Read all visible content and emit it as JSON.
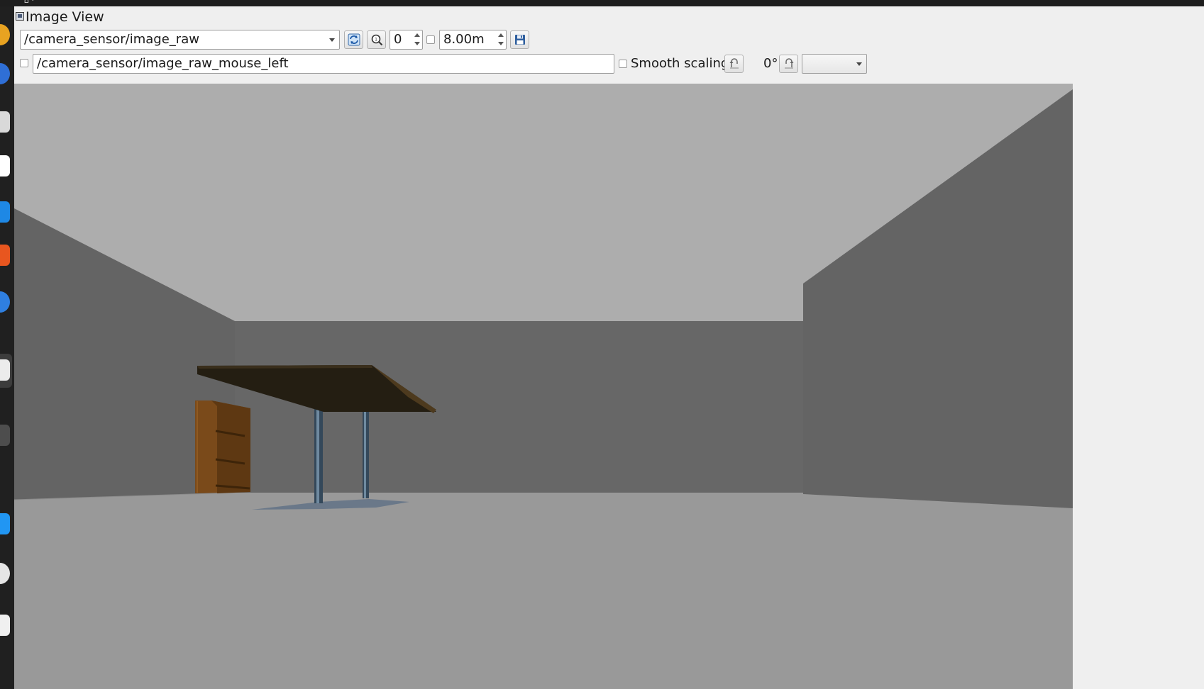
{
  "window": {
    "title": "Image View"
  },
  "toolbar": {
    "topic": "/camera_sensor/image_raw",
    "refresh_icon": "refresh-icon",
    "zoom_icon": "zoom-icon",
    "zoom_value": "0",
    "max_range_checked": false,
    "max_range_value": "8.00m",
    "save_icon": "save-icon"
  },
  "toolbar2": {
    "mouse_checked": false,
    "mouse_topic": "/camera_sensor/image_raw_mouse_left",
    "smooth_scaling_checked": false,
    "smooth_scaling_label": "Smooth scaling",
    "rotate_left_icon": "rotate-left-icon",
    "rotation_value": "0°",
    "rotate_right_icon": "rotate-right-icon",
    "extra_select_value": ""
  },
  "colors": {
    "ceiling": "#adadad",
    "wall_back": "#676767",
    "wall_side": "#646464",
    "floor": "#999999",
    "table_top": "#241e12",
    "bookshelf": "#6e4418",
    "table_leg": "#3b5366"
  }
}
